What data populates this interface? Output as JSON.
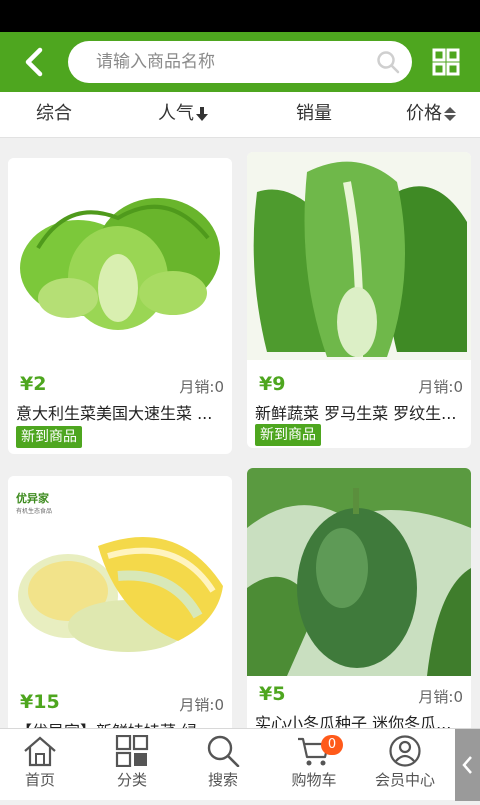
{
  "search": {
    "placeholder": "请输入商品名称"
  },
  "sort_tabs": [
    "综合",
    "人气",
    "销量",
    "价格"
  ],
  "products": [
    {
      "price": "¥2",
      "sales": "月销:0",
      "title": "意大利生菜美国大速生菜 ...",
      "badge": "新到商品"
    },
    {
      "price": "¥9",
      "sales": "月销:0",
      "title": "新鲜蔬菜 罗马生菜 罗纹生...",
      "badge": "新到商品"
    },
    {
      "price": "¥15",
      "sales": "月销:0",
      "title": "【优异家】新鲜娃娃菜 绿...",
      "logo_text": "优异家",
      "logo_sub": "有机生态食品"
    },
    {
      "price": "¥5",
      "sales": "月销:0",
      "title": "实心小冬瓜种子 迷你冬瓜..."
    }
  ],
  "tabbar": {
    "items": [
      "首页",
      "分类",
      "搜索",
      "购物车",
      "会员中心"
    ],
    "cart_count": "0"
  },
  "colors": {
    "brand": "#4ea61f",
    "badge": "#ff5a1a"
  }
}
